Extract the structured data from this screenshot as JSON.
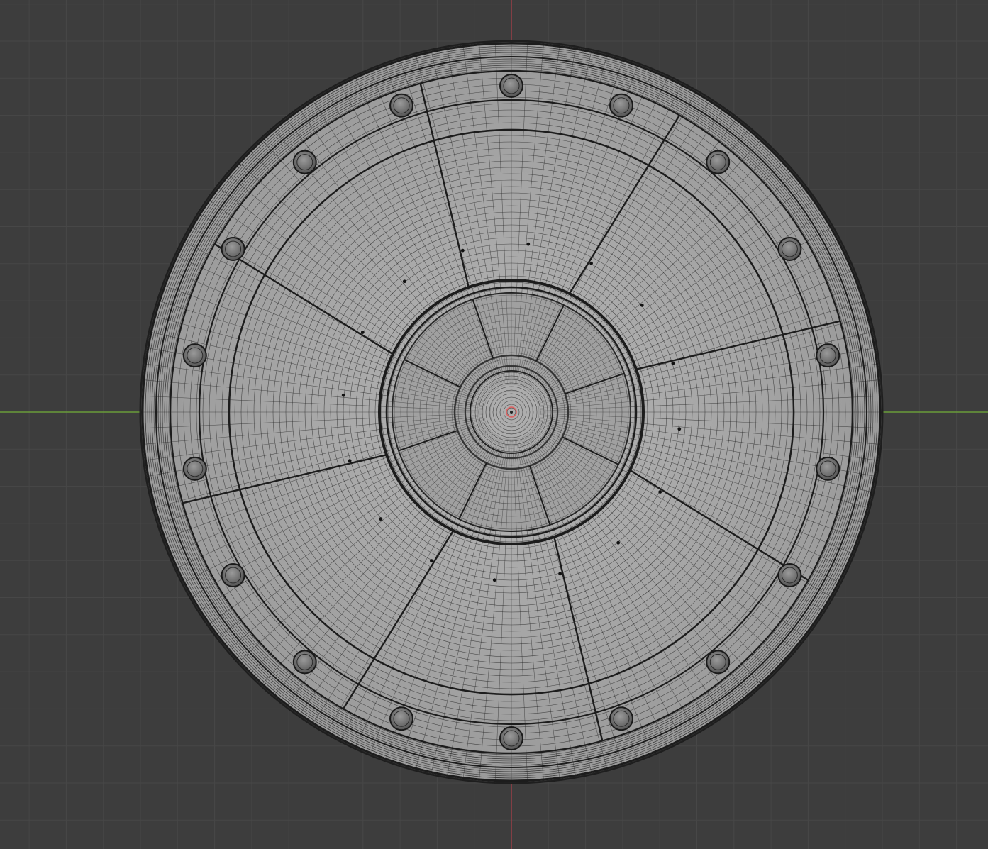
{
  "viewport": {
    "mode": "wireframe-overlay",
    "view": "top-orthographic",
    "object": "circular-hatch-disc",
    "background_color": "#3d3d3d",
    "grid_color": "#474747",
    "x_axis_color": "#6a9c3a",
    "y_axis_color": "#9a3e46",
    "mesh_fill_color": "#a8a8a8",
    "wire_color": "#2a2a2a",
    "bolt_count": 18,
    "spoke_count": 8,
    "rivet_count": 16,
    "origin_marker_color": "#e06060"
  }
}
